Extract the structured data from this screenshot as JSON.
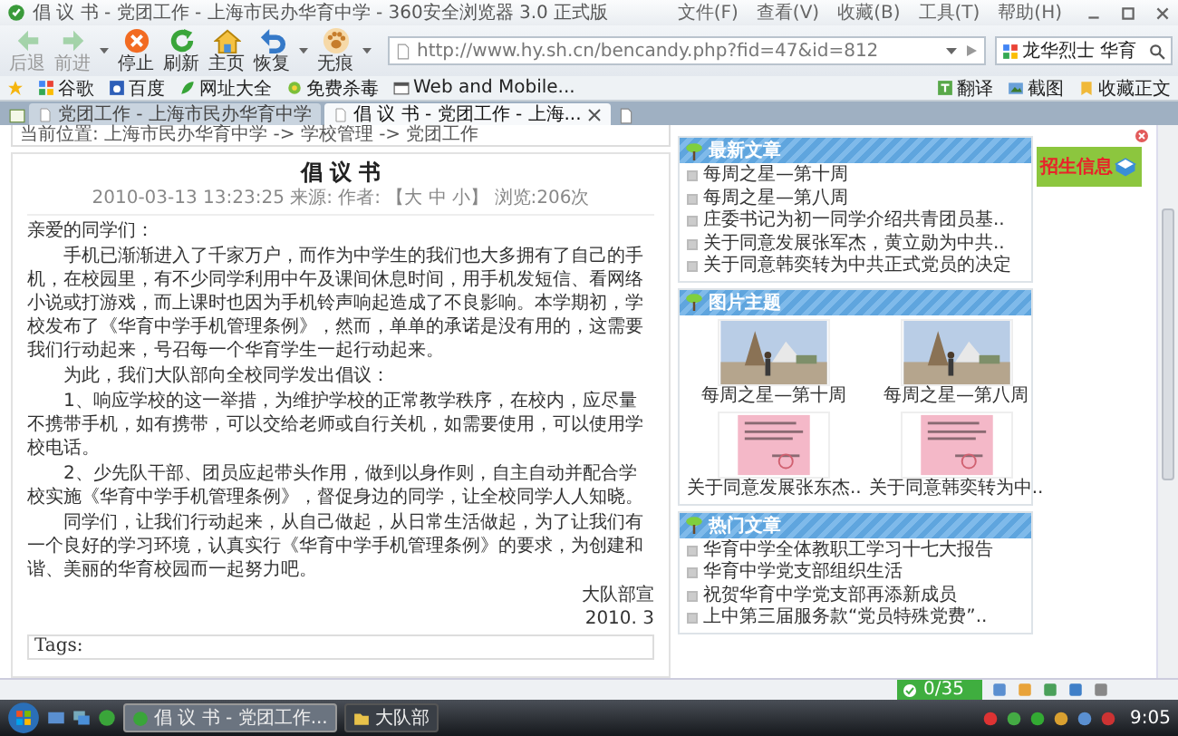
{
  "window": {
    "title": "倡 议 书 - 党团工作 - 上海市民办华育中学 - 360安全浏览器 3.0 正式版",
    "menu": [
      "文件(F)",
      "查看(V)",
      "收藏(B)",
      "工具(T)",
      "帮助(H)"
    ]
  },
  "toolbar": {
    "buttons": [
      {
        "label": "后退",
        "kind": "back",
        "disabled": true
      },
      {
        "label": "前进",
        "kind": "forward",
        "disabled": true
      },
      {
        "label": "停止",
        "kind": "stop",
        "disabled": false
      },
      {
        "label": "刷新",
        "kind": "refresh",
        "disabled": false
      },
      {
        "label": "主页",
        "kind": "home",
        "disabled": false
      },
      {
        "label": "恢复",
        "kind": "restore",
        "disabled": false
      },
      {
        "label": "无痕",
        "kind": "private",
        "disabled": false
      }
    ]
  },
  "address": {
    "url": "http://www.hy.sh.cn/bencandy.php?fid=47&id=812"
  },
  "search": {
    "value": "龙华烈士 华育"
  },
  "bookmarks": {
    "items": [
      {
        "label": "谷歌",
        "kind": "google"
      },
      {
        "label": "百度",
        "kind": "baidu"
      },
      {
        "label": "网址大全",
        "kind": "sites"
      },
      {
        "label": "免费杀毒",
        "kind": "antivirus"
      },
      {
        "label": "Web and Mobile...",
        "kind": "page"
      }
    ],
    "tools": [
      {
        "label": "翻译",
        "kind": "translate"
      },
      {
        "label": "截图",
        "kind": "screenshot"
      },
      {
        "label": "收藏正文",
        "kind": "favorite"
      }
    ]
  },
  "tabs": [
    {
      "label": "党团工作 - 上海市民办华育中学",
      "selected": false
    },
    {
      "label": "倡 议 书 - 党团工作 - 上海...",
      "selected": true
    }
  ],
  "breadcrumb": "当前位置: 上海市民办华育中学 -> 学校管理 -> 党团工作",
  "article": {
    "title": "倡 议 书",
    "meta": "2010-03-13 13:23:25 来源: 作者: 【大 中 小】 浏览:206次",
    "paragraphs": [
      {
        "kind": "salutation",
        "text": "亲爱的同学们："
      },
      {
        "kind": "body",
        "text": "手机已渐渐进入了千家万户，而作为中学生的我们也大多拥有了自己的手机，在校园里，有不少同学利用中午及课间休息时间，用手机发短信、看网络小说或打游戏，而上课时也因为手机铃声响起造成了不良影响。本学期初，学校发布了《华育中学手机管理条例》，然而，单单的承诺是没有用的，这需要我们行动起来，号召每一个华育学生一起行动起来。"
      },
      {
        "kind": "body",
        "text": "为此，我们大队部向全校同学发出倡议："
      },
      {
        "kind": "body",
        "text": "1、响应学校的这一举措，为维护学校的正常教学秩序，在校内，应尽量不携带手机，如有携带，可以交给老师或自行关机，如需要使用，可以使用学校电话。"
      },
      {
        "kind": "body",
        "text": "2、少先队干部、团员应起带头作用，做到以身作则，自主自动并配合学校实施《华育中学手机管理条例》，督促身边的同学，让全校同学人人知晓。"
      },
      {
        "kind": "body",
        "text": "同学们，让我们行动起来，从自己做起，从日常生活做起，为了让我们有一个良好的学习环境，认真实行《华育中学手机管理条例》的要求，为创建和谐、美丽的华育校园而一起努力吧。"
      }
    ],
    "signature": "大队部宣",
    "date": "2010. 3",
    "tags_label": "Tags:"
  },
  "sidebar": [
    {
      "title": "最新文章",
      "kind": "list",
      "items": [
        "每周之星—第十周",
        "每周之星—第八周",
        "庄委书记为初一同学介绍共青团员基..",
        "关于同意发展张军杰，黄立勋为中共..",
        "关于同意韩奕转为中共正式党员的决定"
      ]
    },
    {
      "title": "图片主题",
      "kind": "gallery",
      "items": [
        {
          "caption": "每周之星—第十周"
        },
        {
          "caption": "每周之星—第八周"
        },
        {
          "caption": "关于同意发展张东杰..",
          "kind": "document"
        },
        {
          "caption": "关于同意韩奕转为中..",
          "kind": "document"
        }
      ]
    },
    {
      "title": "热门文章",
      "kind": "list",
      "items": [
        "华育中学全体教职工学习十七大报告",
        "华育中学党支部组织生活",
        "祝贺华育中学党支部再添新成员",
        "上中第三届服务款“党员特殊党费”.."
      ]
    }
  ],
  "ad": {
    "label": "招生信息"
  },
  "status_bar": {
    "counter": "0/35"
  },
  "taskbar": {
    "tasks": [
      {
        "label": "倡 议 书 - 党团工作...",
        "selected": true
      },
      {
        "label": "大队部",
        "selected": false
      }
    ],
    "clock": "9:05"
  }
}
